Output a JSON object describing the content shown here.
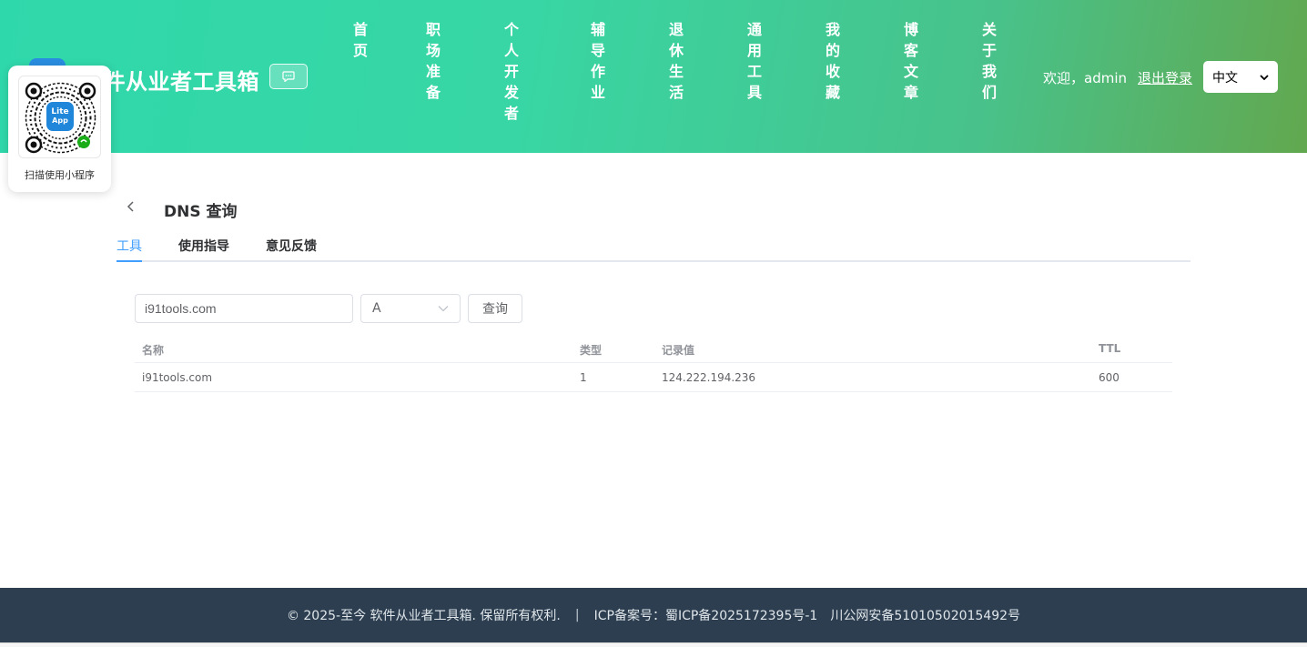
{
  "header": {
    "site_title": "件从业者工具箱",
    "nav": [
      "首页",
      "职场准备",
      "个人开发者",
      "辅导作业",
      "退休生活",
      "通用工具",
      "我的收藏",
      "博客文章",
      "关于我们"
    ],
    "welcome": "欢迎，admin",
    "logout": "退出登录",
    "language": "中文"
  },
  "qr_popup": {
    "badge_line1": "Lite",
    "badge_line2": "App",
    "caption": "扫描使用小程序"
  },
  "page": {
    "title": "DNS 查询",
    "tabs": [
      "工具",
      "使用指导",
      "意见反馈"
    ],
    "active_tab": "工具"
  },
  "query_form": {
    "domain_value": "i91tools.com",
    "record_type": "A",
    "submit_label": "查询"
  },
  "results_table": {
    "headers": [
      "名称",
      "类型",
      "记录值",
      "TTL"
    ],
    "rows": [
      [
        "i91tools.com",
        "1",
        "124.222.194.236",
        "600"
      ]
    ]
  },
  "footer": {
    "copyright": "© 2025-至今 软件从业者工具箱. 保留所有权利.",
    "separator": "|",
    "icp": "ICP备案号：蜀ICP备2025172395号-1",
    "police": "川公网安备51010502015492号"
  }
}
